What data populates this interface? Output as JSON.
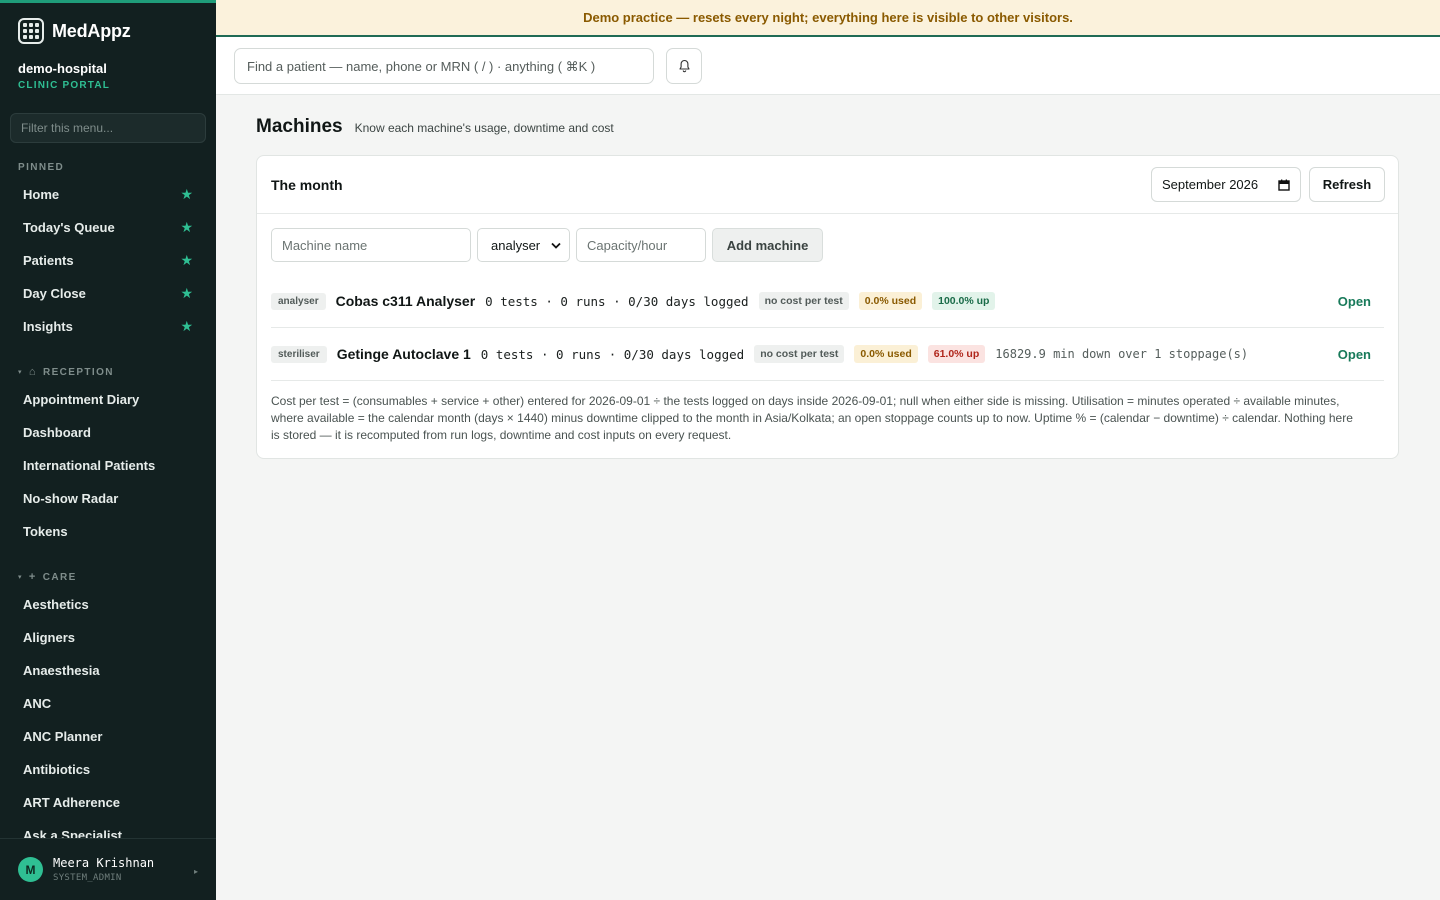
{
  "app": {
    "name": "MedAppz"
  },
  "org": {
    "name": "demo-hospital",
    "subtitle": "CLINIC PORTAL"
  },
  "sidebar": {
    "filter_placeholder": "Filter this menu...",
    "pinned_label": "PINNED",
    "pinned": [
      {
        "label": "Home"
      },
      {
        "label": "Today's Queue"
      },
      {
        "label": "Patients"
      },
      {
        "label": "Day Close"
      },
      {
        "label": "Insights"
      }
    ],
    "reception_label": "RECEPTION",
    "reception": [
      {
        "label": "Appointment Diary"
      },
      {
        "label": "Dashboard"
      },
      {
        "label": "International Patients"
      },
      {
        "label": "No-show Radar"
      },
      {
        "label": "Tokens"
      }
    ],
    "care_label": "CARE",
    "care": [
      {
        "label": "Aesthetics"
      },
      {
        "label": "Aligners"
      },
      {
        "label": "Anaesthesia"
      },
      {
        "label": "ANC"
      },
      {
        "label": "ANC Planner"
      },
      {
        "label": "Antibiotics"
      },
      {
        "label": "ART Adherence"
      },
      {
        "label": "Ask a Specialist"
      }
    ]
  },
  "user": {
    "initial": "M",
    "name": "Meera Krishnan",
    "role": "SYSTEM_ADMIN"
  },
  "banner": {
    "text": "Demo practice — resets every night; everything here is visible to other visitors."
  },
  "topbar": {
    "search_placeholder": "Find a patient — name, phone or MRN ( / ) · anything ( ⌘K )"
  },
  "page": {
    "title": "Machines",
    "subtitle": "Know each machine's usage, downtime and cost"
  },
  "card": {
    "title": "The month",
    "month_value": "September 2026",
    "refresh_label": "Refresh",
    "add_form": {
      "name_placeholder": "Machine name",
      "type_value": "analyser",
      "capacity_placeholder": "Capacity/hour",
      "add_label": "Add machine"
    },
    "machines": [
      {
        "type": "analyser",
        "name": "Cobas c311 Analyser",
        "stats": "0 tests · 0 runs · 0/30 days logged",
        "cost": "no cost per test",
        "used": "0.0% used",
        "uptime": "100.0% up",
        "downtime": "",
        "open_label": "Open"
      },
      {
        "type": "steriliser",
        "name": "Getinge Autoclave 1",
        "stats": "0 tests · 0 runs · 0/30 days logged",
        "cost": "no cost per test",
        "used": "0.0% used",
        "uptime": "61.0% up",
        "downtime": "16829.9 min down over 1 stoppage(s)",
        "open_label": "Open"
      }
    ],
    "footnote": "Cost per test = (consumables + service + other) entered for 2026-09-01 ÷ the tests logged on days inside 2026-09-01; null when either side is missing. Utilisation = minutes operated ÷ available minutes, where available = the calendar month (days × 1440) minus downtime clipped to the month in Asia/Kolkata; an open stoppage counts up to now. Uptime % = (calendar − downtime) ÷ calendar. Nothing here is stored — it is recomputed from run logs, downtime and cost inputs on every request."
  },
  "colors": {
    "sidebar": "#122020",
    "accent": "#2fbf93",
    "banner_bg": "#fbf2dc",
    "banner_text": "#8a5a00",
    "link": "#187a5a"
  }
}
